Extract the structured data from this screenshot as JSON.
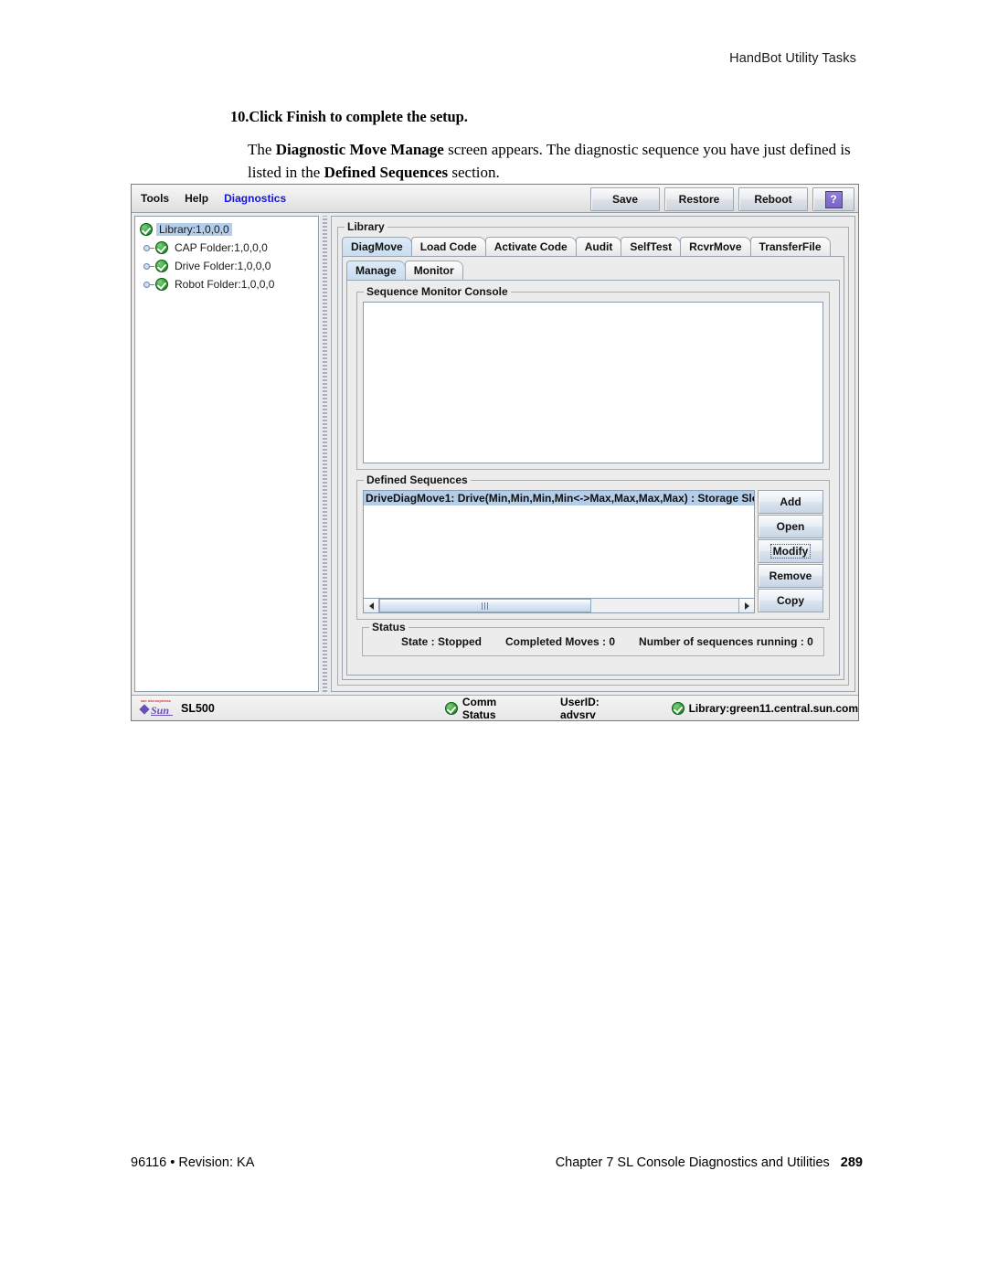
{
  "document": {
    "header": "HandBot Utility Tasks",
    "step": {
      "number": "10.",
      "heading": "Click Finish to complete the setup.",
      "body_1": "The ",
      "body_b1": "Diagnostic Move Manage",
      "body_2": " screen appears. The diagnostic sequence you have just defined is listed in the ",
      "body_b2": "Defined Sequences",
      "body_3": " section."
    },
    "footer": {
      "left": "96116 • Revision: KA",
      "chapter": "Chapter 7 SL Console Diagnostics and Utilities",
      "page": "289"
    }
  },
  "app": {
    "menubar": {
      "items": [
        {
          "label": "Tools",
          "active": false
        },
        {
          "label": "Help",
          "active": false
        },
        {
          "label": "Diagnostics",
          "active": true
        }
      ]
    },
    "toolbar": {
      "save_label": "Save",
      "restore_label": "Restore",
      "reboot_label": "Reboot",
      "help_label": "?"
    },
    "tree": {
      "nodes": [
        {
          "label": "Library:1,0,0,0",
          "selected": true,
          "has_handle": false,
          "indent": 0
        },
        {
          "label": "CAP Folder:1,0,0,0",
          "selected": false,
          "has_handle": true,
          "indent": 1
        },
        {
          "label": "Drive Folder:1,0,0,0",
          "selected": false,
          "has_handle": true,
          "indent": 1
        },
        {
          "label": "Robot Folder:1,0,0,0",
          "selected": false,
          "has_handle": true,
          "indent": 1
        }
      ]
    },
    "main": {
      "group_title": "Library",
      "tabs": [
        {
          "label": "DiagMove",
          "selected": true
        },
        {
          "label": "Load Code",
          "selected": false
        },
        {
          "label": "Activate Code",
          "selected": false
        },
        {
          "label": "Audit",
          "selected": false
        },
        {
          "label": "SelfTest",
          "selected": false
        },
        {
          "label": "RcvrMove",
          "selected": false
        },
        {
          "label": "TransferFile",
          "selected": false
        }
      ],
      "subtabs": [
        {
          "label": "Manage",
          "selected": true
        },
        {
          "label": "Monitor",
          "selected": false
        }
      ],
      "console": {
        "title": "Sequence Monitor Console",
        "content": ""
      },
      "defined_sequences": {
        "title": "Defined Sequences",
        "rows": [
          {
            "text": "DriveDiagMove1: Drive(Min,Min,Min,Min<->Max,Max,Max,Max) : Storage Slots",
            "selected": true
          }
        ],
        "buttons": [
          {
            "label": "Add",
            "focused": false
          },
          {
            "label": "Open",
            "focused": false
          },
          {
            "label": "Modify",
            "focused": true
          },
          {
            "label": "Remove",
            "focused": false
          },
          {
            "label": "Copy",
            "focused": false
          }
        ]
      },
      "status": {
        "title": "Status",
        "state": "State : Stopped",
        "completed_moves": "Completed Moves : 0",
        "sequences_running": "Number of sequences running : 0"
      }
    },
    "statusbar": {
      "brand_tagline": "sun microsystems",
      "brand_word": "Sun",
      "model": "SL500",
      "comm_status": "Comm Status",
      "user_id": "UserID: advsrv",
      "library_host": "Library:green11.central.sun.com"
    },
    "colors": {
      "accent_blue": "#1414e0",
      "selection_blue": "#b4cde8",
      "status_green": "#14701c",
      "help_purple": "#7a64c6"
    }
  }
}
